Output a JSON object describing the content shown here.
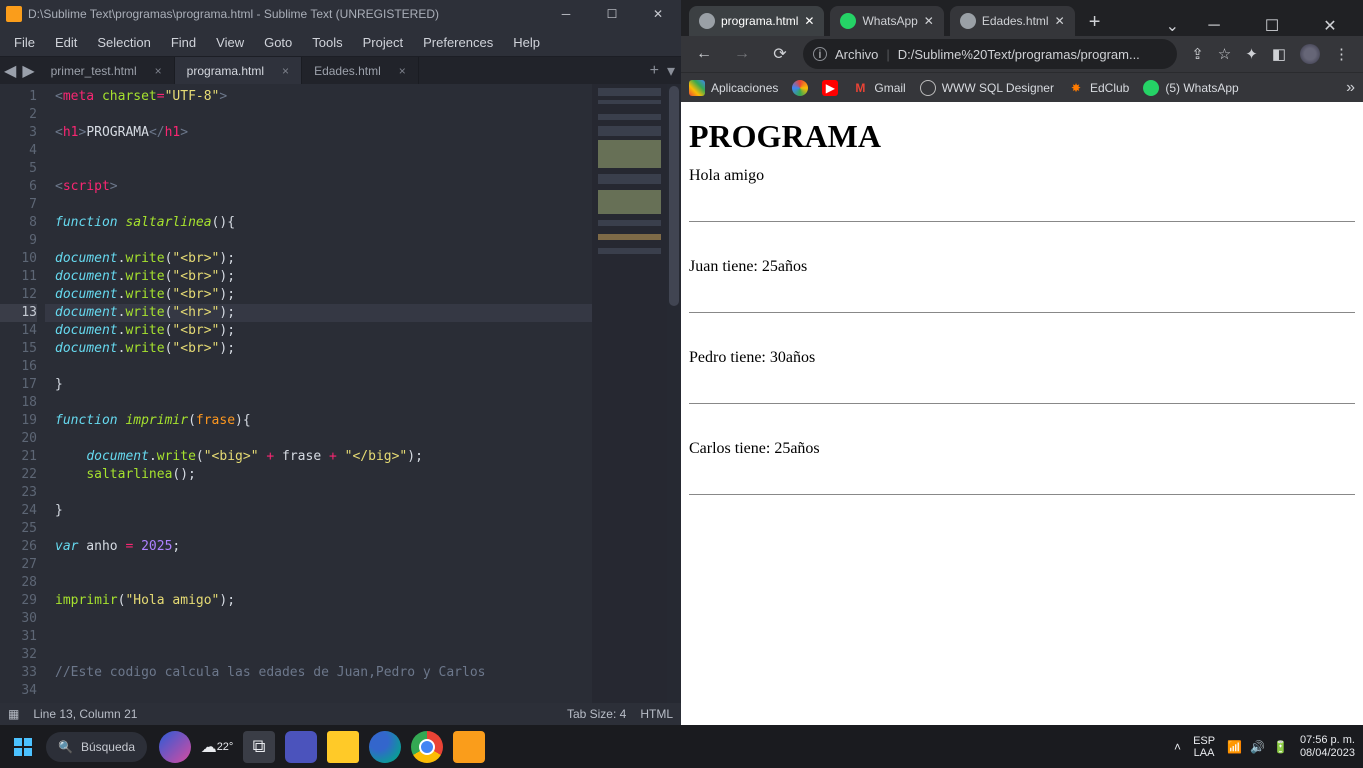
{
  "sublime": {
    "title": "D:\\Sublime Text\\programas\\programa.html - Sublime Text (UNREGISTERED)",
    "menu": [
      "File",
      "Edit",
      "Selection",
      "Find",
      "View",
      "Goto",
      "Tools",
      "Project",
      "Preferences",
      "Help"
    ],
    "tabs": [
      {
        "label": "primer_test.html",
        "active": false
      },
      {
        "label": "programa.html",
        "active": true
      },
      {
        "label": "Edades.html",
        "active": false
      }
    ],
    "status": {
      "left": "Line 13, Column 21",
      "tab": "Tab Size: 4",
      "lang": "HTML"
    },
    "code": {
      "lines_start": 1,
      "lines_end": 34,
      "highlight_line": 13
    }
  },
  "chrome": {
    "tabs": [
      {
        "label": "programa.html",
        "active": true,
        "favicon": "#9aa0a6"
      },
      {
        "label": "WhatsApp",
        "active": false,
        "favicon": "#25d366"
      },
      {
        "label": "Edades.html",
        "active": false,
        "favicon": "#9aa0a6"
      }
    ],
    "omni_prefix": "Archivo",
    "omni_url": "D:/Sublime%20Text/programas/program...",
    "bookmarks": [
      {
        "label": "Aplicaciones",
        "color": "#5f6368"
      },
      {
        "label": "",
        "color": "#ea4335"
      },
      {
        "label": "",
        "color": "#ff0000"
      },
      {
        "label": "Gmail",
        "color": "#ea4335"
      },
      {
        "label": "WWW SQL Designer",
        "color": "#ffffff"
      },
      {
        "label": "EdClub",
        "color": "#ff7b00"
      },
      {
        "label": "(5) WhatsApp",
        "color": "#25d366"
      }
    ],
    "page": {
      "heading": "PROGRAMA",
      "lines": [
        "Hola amigo",
        "Juan tiene: 25años",
        "Pedro tiene: 30años",
        "Carlos tiene: 25años"
      ]
    }
  },
  "taskbar": {
    "search_placeholder": "Búsqueda",
    "weather": "22°",
    "lang1": "ESP",
    "lang2": "LAA",
    "time": "07:56 p. m.",
    "date": "08/04/2023"
  }
}
